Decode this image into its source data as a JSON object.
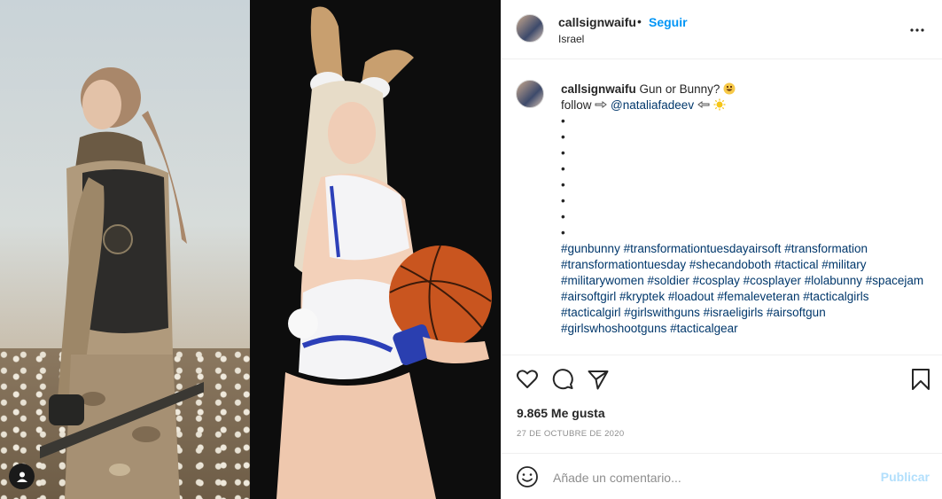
{
  "post": {
    "username": "callsignwaifu",
    "separator": "•",
    "follow_label": "Seguir",
    "location": "Israel",
    "more_icon": "more-horizontal-icon"
  },
  "caption": {
    "username": "callsignwaifu",
    "text": "Gun or Bunny?",
    "follow_prefix": "follow",
    "mention": "@nataliafadeev",
    "bullets": [
      "•",
      "•",
      "•",
      "•",
      "•",
      "•",
      "•",
      "•"
    ],
    "hashtags": [
      "#gunbunny",
      "#transformationtuesdayairsoft",
      "#transformation",
      "#transformationtuesday",
      "#shecandoboth",
      "#tactical",
      "#military",
      "#militarywomen",
      "#soldier",
      "#cosplay",
      "#cosplayer",
      "#lolabunny",
      "#spacejam",
      "#airsoftgirl",
      "#kryptek",
      "#loadout",
      "#femaleveteran",
      "#tacticalgirls",
      "#tacticalgirl",
      "#girlswithguns",
      "#israeligirls",
      "#airsoftgun",
      "#girlswhoshootguns",
      "#tacticalgear"
    ]
  },
  "stats": {
    "likes": "9.865 Me gusta",
    "date": "27 de octubre de 2020"
  },
  "comment_box": {
    "placeholder": "Añade un comentario...",
    "publish_label": "Publicar"
  },
  "colors": {
    "accent": "#0095f6",
    "link": "#00376b",
    "muted": "#8e8e8e",
    "border": "#efefef",
    "publish_disabled": "#b2dffc"
  },
  "icons": {
    "like": "heart-icon",
    "comment": "comment-bubble-icon",
    "share": "paper-plane-icon",
    "save": "bookmark-icon",
    "emoji": "smiley-face-icon",
    "user_tag": "user-tag-icon"
  }
}
